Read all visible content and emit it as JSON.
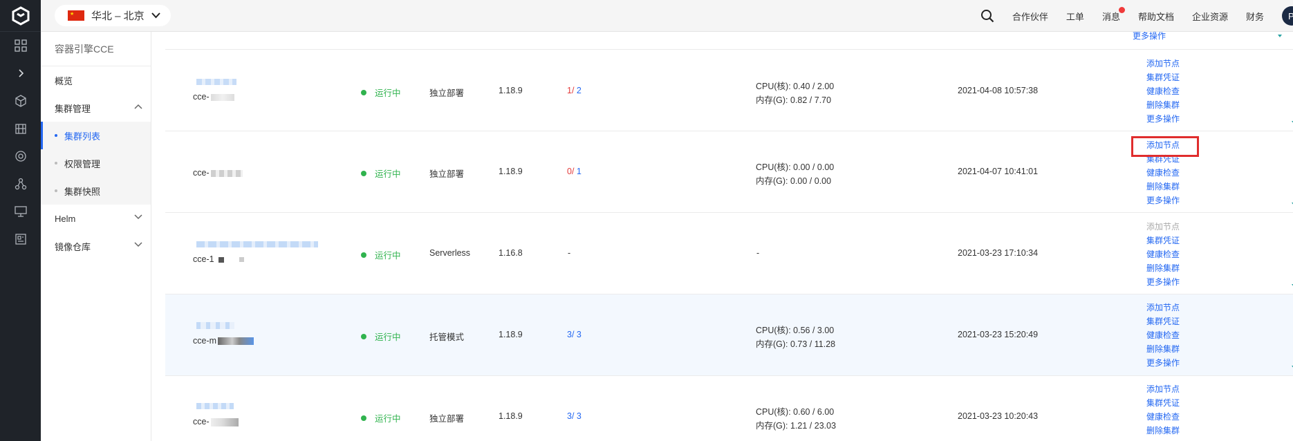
{
  "header": {
    "region": "华北 – 北京",
    "nav": [
      "合作伙伴",
      "工单",
      "消息",
      "帮助文档",
      "企业资源",
      "财务"
    ],
    "avatar": "P"
  },
  "sidebar": {
    "title": "容器引擎CCE",
    "overview": "概览",
    "cluster_mgmt": "集群管理",
    "cluster_list": "集群列表",
    "perm_mgmt": "权限管理",
    "snapshot": "集群快照",
    "helm": "Helm",
    "registry": "镜像仓库"
  },
  "table": {
    "top_partial_op": "更多操作",
    "rows": [
      {
        "name": "cce-",
        "status": "运行中",
        "mode": "独立部署",
        "version": "1.18.9",
        "nodes_a": "1",
        "nodes_sep": "/ ",
        "nodes_b": "2",
        "cpu": "CPU(核): 0.40 / 2.00",
        "mem": "内存(G):   0.82 / 7.70",
        "created": "2021-04-08 10:57:38",
        "ops": [
          "添加节点",
          "集群凭证",
          "健康检查",
          "删除集群",
          "更多操作"
        ]
      },
      {
        "name": "cce-",
        "status": "运行中",
        "mode": "独立部署",
        "version": "1.18.9",
        "nodes_a": "0",
        "nodes_sep": "/ ",
        "nodes_b": "1",
        "cpu": "CPU(核): 0.00 / 0.00",
        "mem": "内存(G):   0.00 / 0.00",
        "created": "2021-04-07 10:41:01",
        "ops": [
          "添加节点",
          "集群凭证",
          "健康检查",
          "删除集群",
          "更多操作"
        ]
      },
      {
        "name": "cce-1",
        "status": "运行中",
        "mode": "Serverless",
        "version": "1.16.8",
        "nodes_plain": "-",
        "res_plain": "-",
        "created": "2021-03-23 17:10:34",
        "ops": [
          "添加节点",
          "集群凭证",
          "健康检查",
          "删除集群",
          "更多操作"
        ]
      },
      {
        "name": "cce-m",
        "status": "运行中",
        "mode": "托管模式",
        "version": "1.18.9",
        "nodes_a": "3",
        "nodes_sep": "/ ",
        "nodes_b": "3",
        "cpu": "CPU(核): 0.56 / 3.00",
        "mem": "内存(G):   0.73 / 11.28",
        "created": "2021-03-23 15:20:49",
        "ops": [
          "添加节点",
          "集群凭证",
          "健康检查",
          "删除集群",
          "更多操作"
        ]
      },
      {
        "name": "cce-",
        "status": "运行中",
        "mode": "独立部署",
        "version": "1.18.9",
        "nodes_a": "3",
        "nodes_sep": "/ ",
        "nodes_b": "3",
        "cpu": "CPU(核): 0.60 / 6.00",
        "mem": "内存(G):   1.21 / 23.03",
        "created": "2021-03-23 10:20:43",
        "ops": [
          "添加节点",
          "集群凭证",
          "健康检查",
          "删除集群"
        ]
      }
    ]
  },
  "colors": {
    "accent": "#2468f2",
    "running": "#30b34e",
    "rail": "#1f2329",
    "highlight": "#e02d2d"
  }
}
